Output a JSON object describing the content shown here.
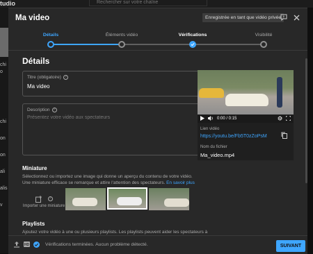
{
  "background": {
    "logo": "tudio",
    "search_placeholder": "Rechercher sur votre chaîne",
    "side_texts": [
      "chi",
      "o",
      "chi",
      "on",
      "on",
      "ali",
      "alis",
      "v"
    ]
  },
  "modal": {
    "title": "Ma video",
    "saved_chip": "Enregistrée en tant que vidéo privée"
  },
  "stepper": {
    "steps": [
      {
        "label": "Détails",
        "state": "active"
      },
      {
        "label": "Éléments vidéo",
        "state": "pending"
      },
      {
        "label": "Vérifications",
        "state": "done"
      },
      {
        "label": "Visibilité",
        "state": "pending"
      }
    ]
  },
  "details": {
    "section_title": "Détails",
    "title_field": {
      "label": "Titre (obligatoire)",
      "value": "Ma video"
    },
    "description_field": {
      "label": "Description",
      "placeholder": "Présentez votre vidéo aux spectateurs"
    }
  },
  "preview": {
    "time": "0:00 / 0:15",
    "link_label": "Lien vidéo",
    "link_value": "https://youtu.be/Fb5T0zZoPsM",
    "file_label": "Nom du fichier",
    "file_value": "Ma_video.mp4"
  },
  "miniature": {
    "title": "Miniature",
    "description": "Sélectionnez ou importez une image qui donne un aperçu du contenu de votre vidéo. Une miniature efficace se remarque et attire l'attention des spectateurs.",
    "learn_more": "En savoir plus",
    "upload_label": "Importer une miniature",
    "selected_index": 1
  },
  "playlists": {
    "title": "Playlists",
    "description": "Ajoutez votre vidéo à une ou plusieurs playlists. Les playlists peuvent aider les spectateurs à"
  },
  "footer": {
    "status": "Vérifications terminées. Aucun problème détecté.",
    "next_label": "SUIVANT",
    "hd_badge": "HD"
  },
  "colors": {
    "accent": "#3ea6ff",
    "modal_bg": "#282828",
    "page_bg": "#0f0f0f"
  }
}
